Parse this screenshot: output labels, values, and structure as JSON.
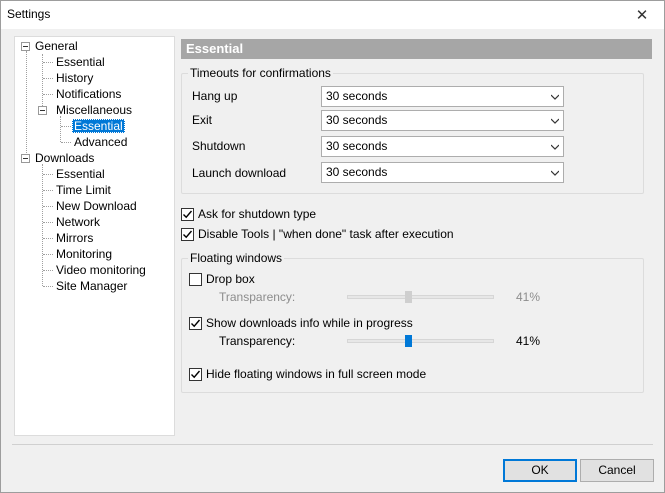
{
  "window": {
    "title": "Settings"
  },
  "tree": {
    "general": "General",
    "general_children": [
      "Essential",
      "History",
      "Notifications"
    ],
    "misc": "Miscellaneous",
    "misc_children": [
      "Essential",
      "Advanced"
    ],
    "downloads": "Downloads",
    "downloads_children": [
      "Essential",
      "Time Limit",
      "New Download",
      "Network",
      "Mirrors",
      "Monitoring",
      "Video monitoring",
      "Site Manager"
    ]
  },
  "panel": {
    "header": "Essential",
    "timeouts": {
      "title": "Timeouts for confirmations",
      "rows": [
        {
          "label": "Hang up",
          "value": "30 seconds"
        },
        {
          "label": "Exit",
          "value": "30 seconds"
        },
        {
          "label": "Shutdown",
          "value": "30 seconds"
        },
        {
          "label": "Launch download",
          "value": "30 seconds"
        }
      ]
    },
    "ask_shutdown": {
      "label": "Ask for shutdown type",
      "checked": true
    },
    "disable_tools": {
      "label": "Disable Tools | \"when done\" task after execution",
      "checked": true
    },
    "floating": {
      "title": "Floating windows",
      "drop_box": {
        "label": "Drop box",
        "checked": false
      },
      "drop_transparency": {
        "label": "Transparency:",
        "value_text": "41%",
        "value": 0.41
      },
      "show_downloads": {
        "label": "Show downloads info while in progress",
        "checked": true
      },
      "show_transparency": {
        "label": "Transparency:",
        "value_text": "41%",
        "value": 0.41
      },
      "hide_fullscreen": {
        "label": "Hide floating windows in full screen mode",
        "checked": true
      }
    }
  },
  "buttons": {
    "ok": "OK",
    "cancel": "Cancel"
  },
  "colors": {
    "selection": "#0078d7",
    "header": "#a6a6a6"
  }
}
